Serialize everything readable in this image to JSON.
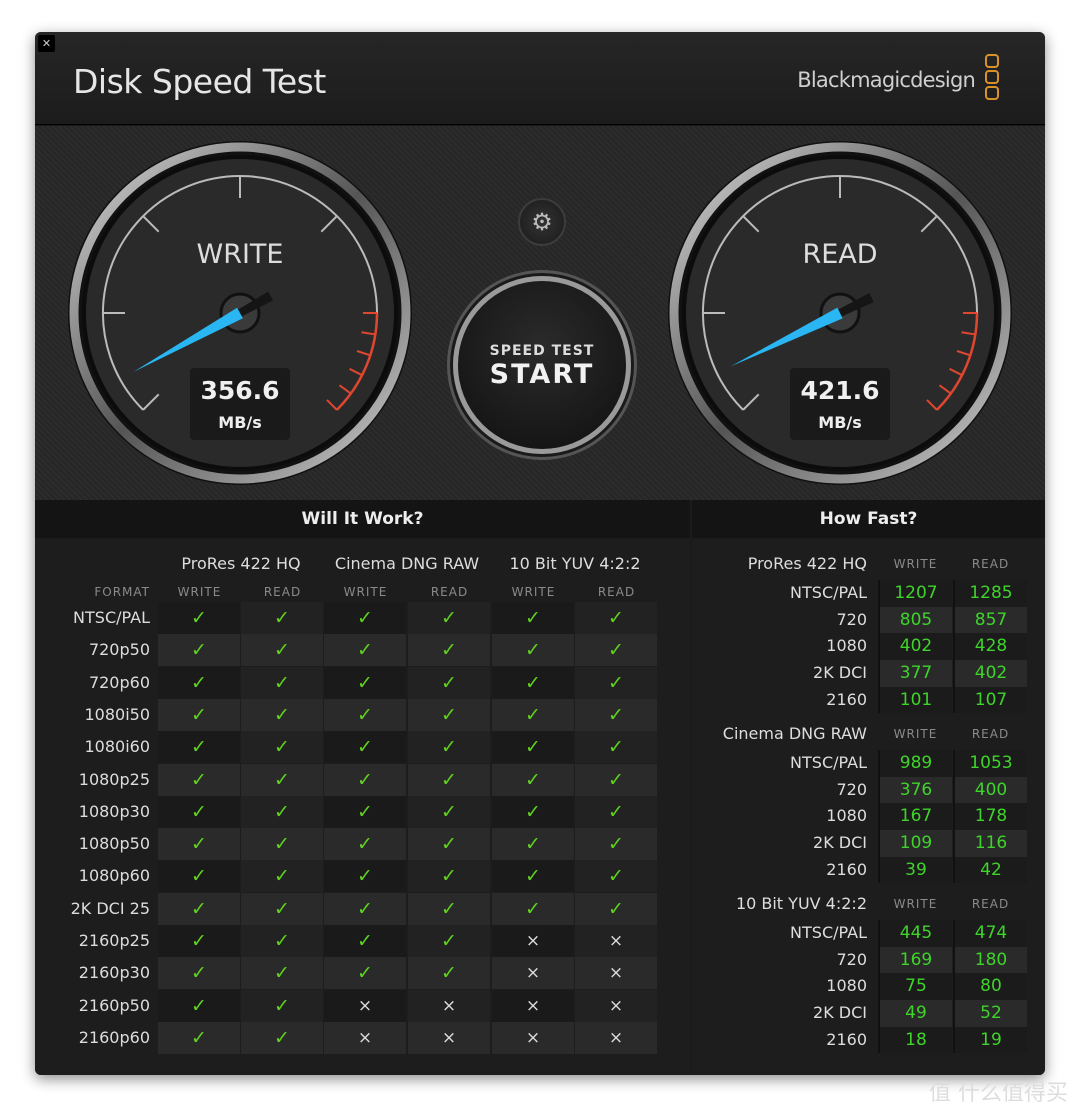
{
  "window": {
    "close_icon": "close-icon",
    "title": "Disk Speed Test",
    "brand": "Blackmagicdesign"
  },
  "gauges": {
    "write": {
      "label": "WRITE",
      "value": "356.6",
      "unit": "MB/s"
    },
    "read": {
      "label": "READ",
      "value": "421.6",
      "unit": "MB/s"
    }
  },
  "settings_icon": "gear-icon",
  "start_button": {
    "line1": "SPEED TEST",
    "line2": "START"
  },
  "colors": {
    "needle": "#29b6f2",
    "redzone": "#e0472f",
    "ok": "#5fd31e",
    "value": "#3ed42a",
    "brand_logo": "#d9922a"
  },
  "will_it_work": {
    "title": "Will It Work?",
    "format_header": "FORMAT",
    "groups": [
      "ProRes 422 HQ",
      "Cinema DNG RAW",
      "10 Bit YUV 4:2:2"
    ],
    "sub": [
      "WRITE",
      "READ"
    ],
    "rows": [
      {
        "format": "NTSC/PAL",
        "ok": [
          true,
          true,
          true,
          true,
          true,
          true
        ]
      },
      {
        "format": "720p50",
        "ok": [
          true,
          true,
          true,
          true,
          true,
          true
        ]
      },
      {
        "format": "720p60",
        "ok": [
          true,
          true,
          true,
          true,
          true,
          true
        ]
      },
      {
        "format": "1080i50",
        "ok": [
          true,
          true,
          true,
          true,
          true,
          true
        ]
      },
      {
        "format": "1080i60",
        "ok": [
          true,
          true,
          true,
          true,
          true,
          true
        ]
      },
      {
        "format": "1080p25",
        "ok": [
          true,
          true,
          true,
          true,
          true,
          true
        ]
      },
      {
        "format": "1080p30",
        "ok": [
          true,
          true,
          true,
          true,
          true,
          true
        ]
      },
      {
        "format": "1080p50",
        "ok": [
          true,
          true,
          true,
          true,
          true,
          true
        ]
      },
      {
        "format": "1080p60",
        "ok": [
          true,
          true,
          true,
          true,
          true,
          true
        ]
      },
      {
        "format": "2K DCI 25",
        "ok": [
          true,
          true,
          true,
          true,
          true,
          true
        ]
      },
      {
        "format": "2160p25",
        "ok": [
          true,
          true,
          true,
          true,
          false,
          false
        ]
      },
      {
        "format": "2160p30",
        "ok": [
          true,
          true,
          true,
          true,
          false,
          false
        ]
      },
      {
        "format": "2160p50",
        "ok": [
          true,
          true,
          false,
          false,
          false,
          false
        ]
      },
      {
        "format": "2160p60",
        "ok": [
          true,
          true,
          false,
          false,
          false,
          false
        ]
      }
    ],
    "ok_symbol": "✓",
    "fail_symbol": "×"
  },
  "how_fast": {
    "title": "How Fast?",
    "sub": [
      "WRITE",
      "READ"
    ],
    "groups": [
      {
        "name": "ProRes 422 HQ",
        "rows": [
          [
            "NTSC/PAL",
            "1207",
            "1285"
          ],
          [
            "720",
            "805",
            "857"
          ],
          [
            "1080",
            "402",
            "428"
          ],
          [
            "2K DCI",
            "377",
            "402"
          ],
          [
            "2160",
            "101",
            "107"
          ]
        ]
      },
      {
        "name": "Cinema DNG RAW",
        "rows": [
          [
            "NTSC/PAL",
            "989",
            "1053"
          ],
          [
            "720",
            "376",
            "400"
          ],
          [
            "1080",
            "167",
            "178"
          ],
          [
            "2K DCI",
            "109",
            "116"
          ],
          [
            "2160",
            "39",
            "42"
          ]
        ]
      },
      {
        "name": "10 Bit YUV 4:2:2",
        "rows": [
          [
            "NTSC/PAL",
            "445",
            "474"
          ],
          [
            "720",
            "169",
            "180"
          ],
          [
            "1080",
            "75",
            "80"
          ],
          [
            "2K DCI",
            "49",
            "52"
          ],
          [
            "2160",
            "18",
            "19"
          ]
        ]
      }
    ]
  },
  "watermark": "值 什么值得买"
}
